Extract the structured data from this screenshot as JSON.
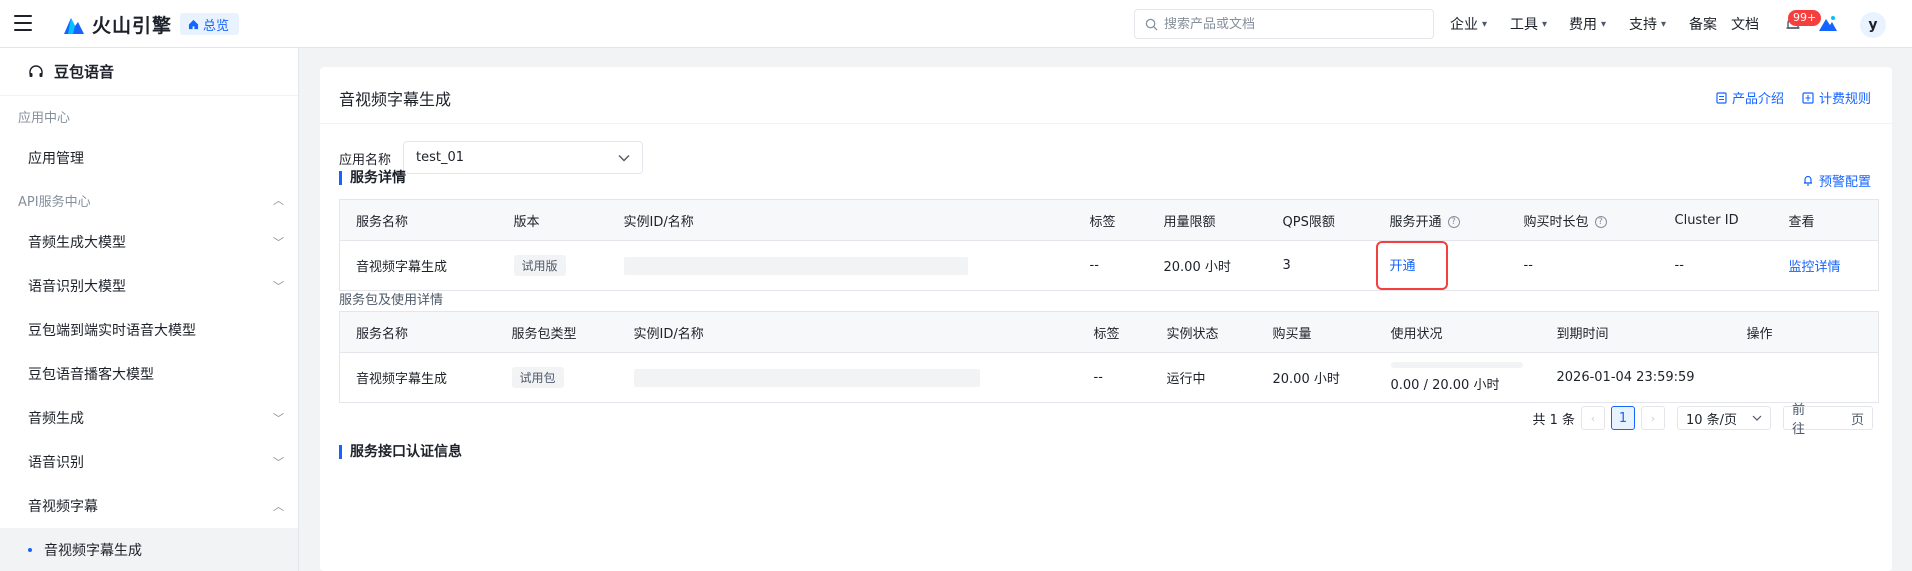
{
  "topbar": {
    "brand": "火山引擎",
    "overview": "总览",
    "search_placeholder": "搜索产品或文档",
    "nav": [
      {
        "label": "企业"
      },
      {
        "label": "工具"
      },
      {
        "label": "费用"
      },
      {
        "label": "支持"
      },
      {
        "label": "备案"
      },
      {
        "label": "文档"
      }
    ],
    "badge": "99+",
    "avatar": "y"
  },
  "sidebar": {
    "product": "豆包语音",
    "group_app": "应用中心",
    "item_app_manage": "应用管理",
    "group_api": "API服务中心",
    "items": [
      {
        "label": "音频生成大模型"
      },
      {
        "label": "语音识别大模型"
      },
      {
        "label": "豆包端到端实时语音大模型"
      },
      {
        "label": "豆包语音播客大模型"
      },
      {
        "label": "音频生成"
      },
      {
        "label": "语音识别"
      },
      {
        "label": "音视频字幕"
      }
    ],
    "active_sub": "音视频字幕生成"
  },
  "main": {
    "title": "音视频字幕生成",
    "link_intro": "产品介绍",
    "link_billing": "计费规则",
    "app_label": "应用名称",
    "app_value": "test_01",
    "service_section": "服务详情",
    "alert_config": "预警配置",
    "service_table": {
      "headers": [
        "服务名称",
        "版本",
        "实例ID/名称",
        "标签",
        "用量限额",
        "QPS限额",
        "服务开通",
        "购买时长包",
        "Cluster ID",
        "查看"
      ],
      "row": {
        "name": "音视频字幕生成",
        "version": "试用版",
        "tag": "--",
        "quota": "20.00 小时",
        "qps": "3",
        "enable": "开通",
        "duration": "--",
        "cluster": "--",
        "view": "监控详情"
      }
    },
    "package_section": "服务包及使用详情",
    "package_table": {
      "headers": [
        "服务名称",
        "服务包类型",
        "实例ID/名称",
        "标签",
        "实例状态",
        "购买量",
        "使用状况",
        "到期时间",
        "操作"
      ],
      "row": {
        "name": "音视频字幕生成",
        "type": "试用包",
        "tag": "--",
        "status": "运行中",
        "amount": "20.00 小时",
        "usage": "0.00 / 20.00 小时",
        "usage_fraction": 0,
        "expire": "2026-01-04 23:59:59",
        "action": ""
      }
    },
    "pager": {
      "total": "共 1 条",
      "current": "1",
      "page_size": "10 条/页",
      "goto": "前往",
      "page_unit": "页"
    },
    "auth_section": "服务接口认证信息"
  },
  "colors": {
    "accent": "#1664ff",
    "highlight_border": "#f53f3f",
    "badge": "#f53f3f"
  }
}
